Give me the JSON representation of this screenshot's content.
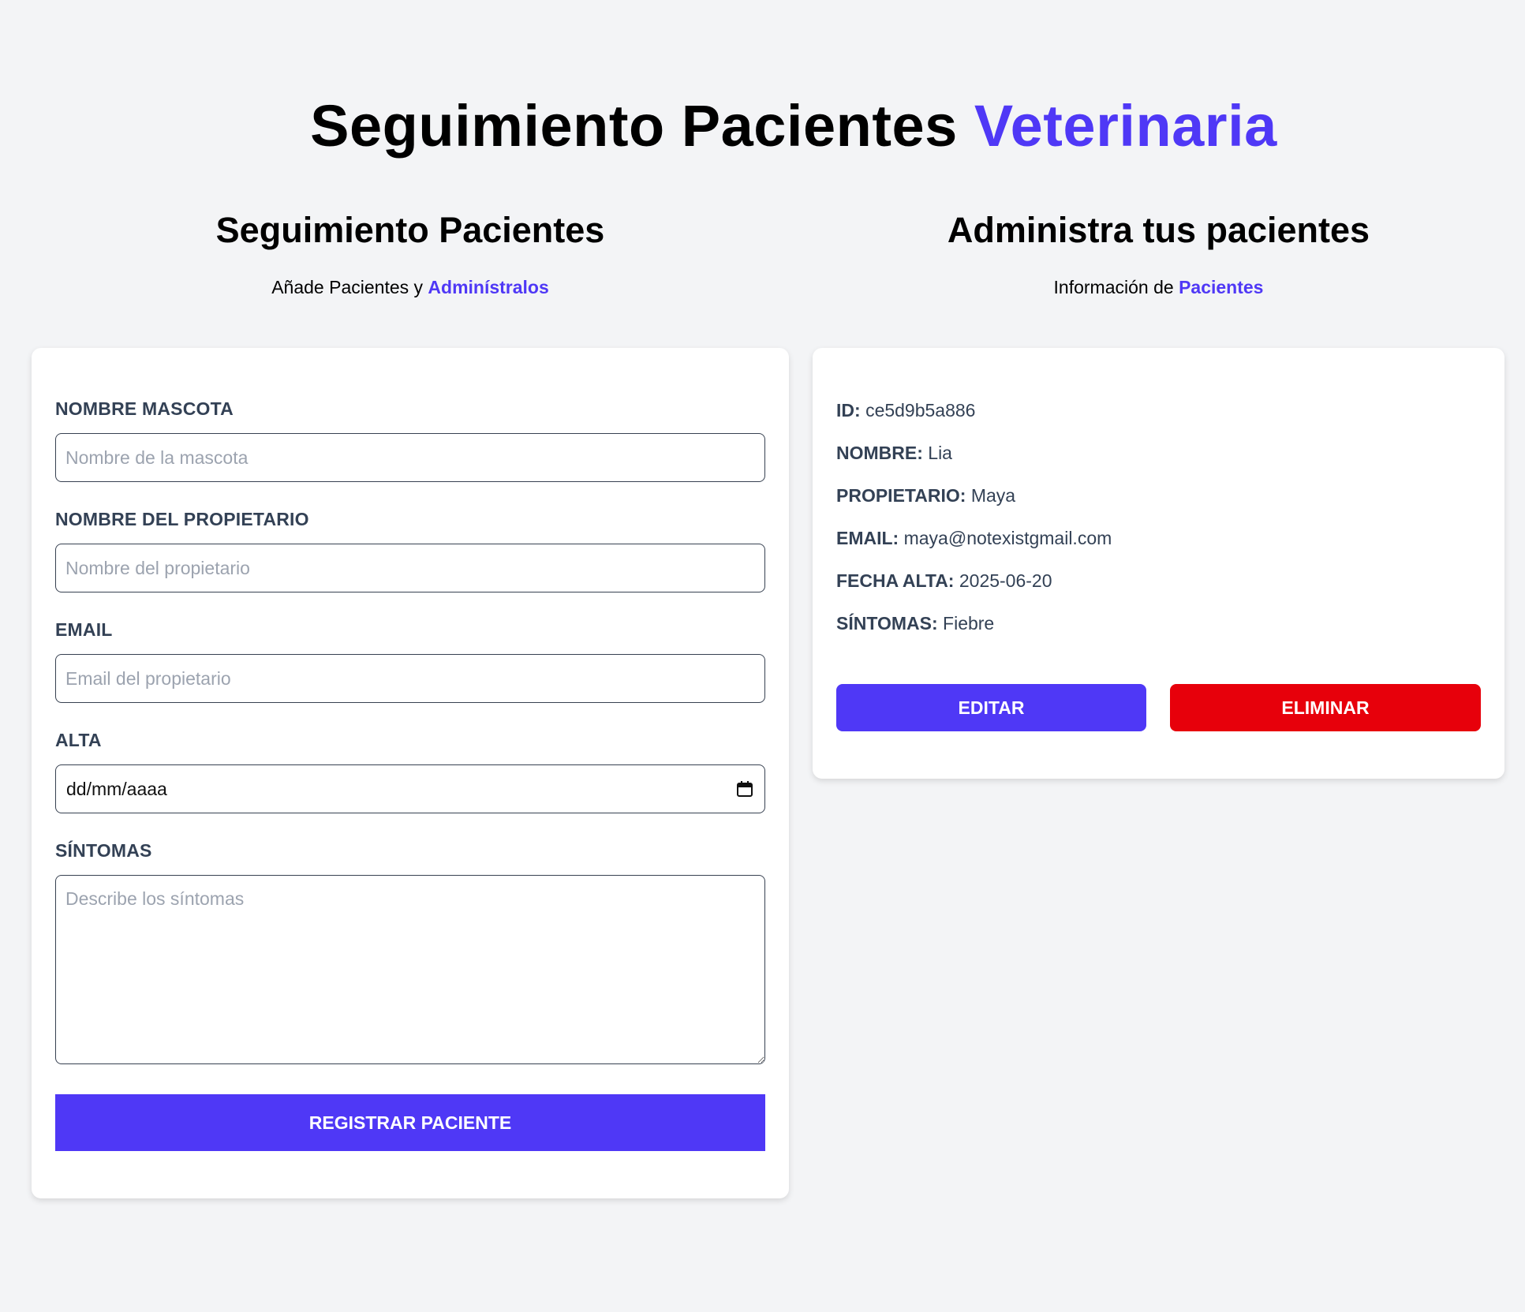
{
  "header": {
    "title_main": "Seguimiento Pacientes",
    "title_accent": "Veterinaria"
  },
  "form_column": {
    "heading": "Seguimiento Pacientes",
    "subtitle_text": "Añade Pacientes y",
    "subtitle_accent": "Adminístralos"
  },
  "list_column": {
    "heading": "Administra tus pacientes",
    "subtitle_text": "Información de",
    "subtitle_accent": "Pacientes"
  },
  "form": {
    "pet_name": {
      "label": "Nombre Mascota",
      "placeholder": "Nombre de la mascota",
      "value": ""
    },
    "owner_name": {
      "label": "Nombre del Propietario",
      "placeholder": "Nombre del propietario",
      "value": ""
    },
    "email": {
      "label": "Email",
      "placeholder": "Email del propietario",
      "value": ""
    },
    "date": {
      "label": "Alta",
      "display": "dd/mm/aaaa"
    },
    "symptoms": {
      "label": "Síntomas",
      "placeholder": "Describe los síntomas",
      "value": ""
    },
    "submit_label": "Registrar Paciente"
  },
  "patient": {
    "id": {
      "key": "ID:",
      "value": "ce5d9b5a886"
    },
    "name": {
      "key": "NOMBRE:",
      "value": "Lia"
    },
    "owner": {
      "key": "PROPIETARIO:",
      "value": "Maya"
    },
    "email": {
      "key": "EMAIL:",
      "value": "maya@notexistgmail.com"
    },
    "date": {
      "key": "FECHA ALTA:",
      "value": "2025-06-20"
    },
    "symptoms": {
      "key": "SÍNTOMAS:",
      "value": "Fiebre"
    },
    "edit_label": "Editar",
    "delete_label": "Eliminar"
  },
  "colors": {
    "accent": "#4f38f6",
    "danger": "#e7000b",
    "background": "#f3f4f6",
    "label": "#334155"
  }
}
